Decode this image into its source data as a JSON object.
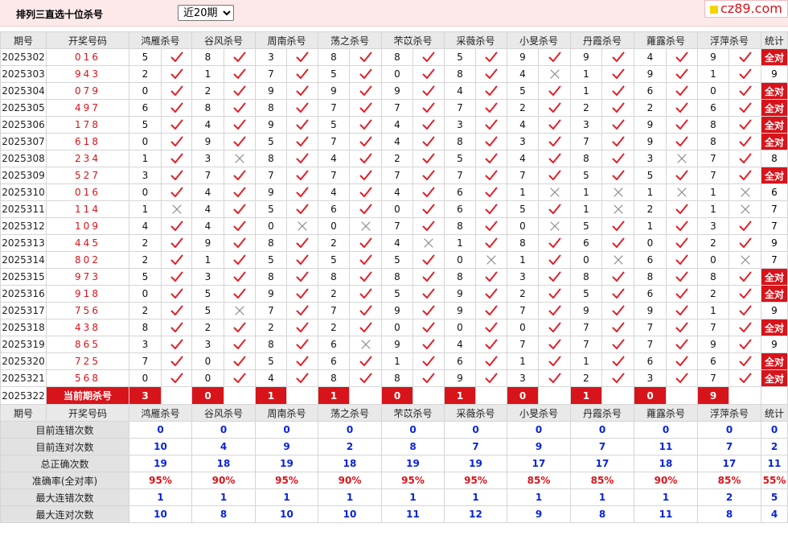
{
  "header": {
    "title": "排列三直选十位杀号",
    "period_selected": "近20期",
    "logo_text": "cz89.com"
  },
  "columns": {
    "period": "期号",
    "draw": "开奖号码",
    "experts": [
      "鸿雁杀号",
      "谷风杀号",
      "周南杀号",
      "荡之杀号",
      "芣苡杀号",
      "采薇杀号",
      "小旻杀号",
      "丹霞杀号",
      "蕹露杀号",
      "浮萍杀号"
    ],
    "stats": "统计"
  },
  "rows": [
    {
      "period": "2025302",
      "draw": "016",
      "kills": [
        [
          5,
          1
        ],
        [
          8,
          1
        ],
        [
          3,
          1
        ],
        [
          8,
          1
        ],
        [
          8,
          1
        ],
        [
          5,
          1
        ],
        [
          9,
          1
        ],
        [
          9,
          1
        ],
        [
          4,
          1
        ],
        [
          9,
          1
        ]
      ],
      "stat": "全对"
    },
    {
      "period": "2025303",
      "draw": "943",
      "kills": [
        [
          2,
          1
        ],
        [
          1,
          1
        ],
        [
          7,
          1
        ],
        [
          5,
          1
        ],
        [
          0,
          1
        ],
        [
          8,
          1
        ],
        [
          4,
          0
        ],
        [
          1,
          1
        ],
        [
          9,
          1
        ],
        [
          1,
          1
        ]
      ],
      "stat": "9"
    },
    {
      "period": "2025304",
      "draw": "079",
      "kills": [
        [
          0,
          1
        ],
        [
          2,
          1
        ],
        [
          9,
          1
        ],
        [
          9,
          1
        ],
        [
          9,
          1
        ],
        [
          4,
          1
        ],
        [
          5,
          1
        ],
        [
          1,
          1
        ],
        [
          6,
          1
        ],
        [
          0,
          1
        ]
      ],
      "stat": "全对"
    },
    {
      "period": "2025305",
      "draw": "497",
      "kills": [
        [
          6,
          1
        ],
        [
          8,
          1
        ],
        [
          8,
          1
        ],
        [
          7,
          1
        ],
        [
          7,
          1
        ],
        [
          7,
          1
        ],
        [
          2,
          1
        ],
        [
          2,
          1
        ],
        [
          2,
          1
        ],
        [
          6,
          1
        ]
      ],
      "stat": "全对"
    },
    {
      "period": "2025306",
      "draw": "178",
      "kills": [
        [
          5,
          1
        ],
        [
          4,
          1
        ],
        [
          9,
          1
        ],
        [
          5,
          1
        ],
        [
          4,
          1
        ],
        [
          3,
          1
        ],
        [
          4,
          1
        ],
        [
          3,
          1
        ],
        [
          9,
          1
        ],
        [
          8,
          1
        ]
      ],
      "stat": "全对"
    },
    {
      "period": "2025307",
      "draw": "618",
      "kills": [
        [
          0,
          1
        ],
        [
          9,
          1
        ],
        [
          5,
          1
        ],
        [
          7,
          1
        ],
        [
          4,
          1
        ],
        [
          8,
          1
        ],
        [
          3,
          1
        ],
        [
          7,
          1
        ],
        [
          9,
          1
        ],
        [
          8,
          1
        ]
      ],
      "stat": "全对"
    },
    {
      "period": "2025308",
      "draw": "234",
      "kills": [
        [
          1,
          1
        ],
        [
          3,
          0
        ],
        [
          8,
          1
        ],
        [
          4,
          1
        ],
        [
          2,
          1
        ],
        [
          5,
          1
        ],
        [
          4,
          1
        ],
        [
          8,
          1
        ],
        [
          3,
          0
        ],
        [
          7,
          1
        ]
      ],
      "stat": "8"
    },
    {
      "period": "2025309",
      "draw": "527",
      "kills": [
        [
          3,
          1
        ],
        [
          7,
          1
        ],
        [
          7,
          1
        ],
        [
          7,
          1
        ],
        [
          7,
          1
        ],
        [
          7,
          1
        ],
        [
          7,
          1
        ],
        [
          5,
          1
        ],
        [
          5,
          1
        ],
        [
          7,
          1
        ]
      ],
      "stat": "全对"
    },
    {
      "period": "2025310",
      "draw": "016",
      "kills": [
        [
          0,
          1
        ],
        [
          4,
          1
        ],
        [
          9,
          1
        ],
        [
          4,
          1
        ],
        [
          4,
          1
        ],
        [
          6,
          1
        ],
        [
          1,
          0
        ],
        [
          1,
          0
        ],
        [
          1,
          0
        ],
        [
          1,
          0
        ]
      ],
      "stat": "6"
    },
    {
      "period": "2025311",
      "draw": "114",
      "kills": [
        [
          1,
          0
        ],
        [
          4,
          1
        ],
        [
          5,
          1
        ],
        [
          6,
          1
        ],
        [
          0,
          1
        ],
        [
          6,
          1
        ],
        [
          5,
          1
        ],
        [
          1,
          0
        ],
        [
          2,
          1
        ],
        [
          1,
          0
        ]
      ],
      "stat": "7"
    },
    {
      "period": "2025312",
      "draw": "109",
      "kills": [
        [
          4,
          1
        ],
        [
          4,
          1
        ],
        [
          0,
          0
        ],
        [
          0,
          0
        ],
        [
          7,
          1
        ],
        [
          8,
          1
        ],
        [
          0,
          0
        ],
        [
          5,
          1
        ],
        [
          1,
          1
        ],
        [
          3,
          1
        ]
      ],
      "stat": "7"
    },
    {
      "period": "2025313",
      "draw": "445",
      "kills": [
        [
          2,
          1
        ],
        [
          9,
          1
        ],
        [
          8,
          1
        ],
        [
          2,
          1
        ],
        [
          4,
          0
        ],
        [
          1,
          1
        ],
        [
          8,
          1
        ],
        [
          6,
          1
        ],
        [
          0,
          1
        ],
        [
          2,
          1
        ]
      ],
      "stat": "9"
    },
    {
      "period": "2025314",
      "draw": "802",
      "kills": [
        [
          2,
          1
        ],
        [
          1,
          1
        ],
        [
          5,
          1
        ],
        [
          5,
          1
        ],
        [
          5,
          1
        ],
        [
          0,
          0
        ],
        [
          1,
          1
        ],
        [
          0,
          0
        ],
        [
          6,
          1
        ],
        [
          0,
          0
        ]
      ],
      "stat": "7"
    },
    {
      "period": "2025315",
      "draw": "973",
      "kills": [
        [
          5,
          1
        ],
        [
          3,
          1
        ],
        [
          8,
          1
        ],
        [
          8,
          1
        ],
        [
          8,
          1
        ],
        [
          8,
          1
        ],
        [
          3,
          1
        ],
        [
          8,
          1
        ],
        [
          8,
          1
        ],
        [
          8,
          1
        ]
      ],
      "stat": "全对"
    },
    {
      "period": "2025316",
      "draw": "918",
      "kills": [
        [
          0,
          1
        ],
        [
          5,
          1
        ],
        [
          9,
          1
        ],
        [
          2,
          1
        ],
        [
          5,
          1
        ],
        [
          9,
          1
        ],
        [
          2,
          1
        ],
        [
          5,
          1
        ],
        [
          6,
          1
        ],
        [
          2,
          1
        ]
      ],
      "stat": "全对"
    },
    {
      "period": "2025317",
      "draw": "756",
      "kills": [
        [
          2,
          1
        ],
        [
          5,
          0
        ],
        [
          7,
          1
        ],
        [
          7,
          1
        ],
        [
          9,
          1
        ],
        [
          9,
          1
        ],
        [
          7,
          1
        ],
        [
          9,
          1
        ],
        [
          9,
          1
        ],
        [
          1,
          1
        ]
      ],
      "stat": "9"
    },
    {
      "period": "2025318",
      "draw": "438",
      "kills": [
        [
          8,
          1
        ],
        [
          2,
          1
        ],
        [
          2,
          1
        ],
        [
          2,
          1
        ],
        [
          0,
          1
        ],
        [
          0,
          1
        ],
        [
          0,
          1
        ],
        [
          7,
          1
        ],
        [
          7,
          1
        ],
        [
          7,
          1
        ]
      ],
      "stat": "全对"
    },
    {
      "period": "2025319",
      "draw": "865",
      "kills": [
        [
          3,
          1
        ],
        [
          3,
          1
        ],
        [
          8,
          1
        ],
        [
          6,
          0
        ],
        [
          9,
          1
        ],
        [
          4,
          1
        ],
        [
          7,
          1
        ],
        [
          7,
          1
        ],
        [
          7,
          1
        ],
        [
          9,
          1
        ]
      ],
      "stat": "9"
    },
    {
      "period": "2025320",
      "draw": "725",
      "kills": [
        [
          7,
          1
        ],
        [
          0,
          1
        ],
        [
          5,
          1
        ],
        [
          6,
          1
        ],
        [
          1,
          1
        ],
        [
          6,
          1
        ],
        [
          1,
          1
        ],
        [
          1,
          1
        ],
        [
          6,
          1
        ],
        [
          6,
          1
        ]
      ],
      "stat": "全对"
    },
    {
      "period": "2025321",
      "draw": "568",
      "kills": [
        [
          0,
          1
        ],
        [
          0,
          1
        ],
        [
          4,
          1
        ],
        [
          8,
          1
        ],
        [
          8,
          1
        ],
        [
          9,
          1
        ],
        [
          3,
          1
        ],
        [
          2,
          1
        ],
        [
          3,
          1
        ],
        [
          7,
          1
        ]
      ],
      "stat": "全对"
    }
  ],
  "current": {
    "period": "2025322",
    "label": "当前期杀号",
    "kills": [
      "3",
      "0",
      "1",
      "1",
      "0",
      "1",
      "0",
      "1",
      "0",
      "9"
    ]
  },
  "stats_rows": [
    {
      "label": "目前连错次数",
      "values": [
        "0",
        "0",
        "0",
        "0",
        "0",
        "0",
        "0",
        "0",
        "0",
        "0",
        "0"
      ],
      "pct": false
    },
    {
      "label": "目前连对次数",
      "values": [
        "10",
        "4",
        "9",
        "2",
        "8",
        "7",
        "9",
        "7",
        "11",
        "7",
        "2"
      ],
      "pct": false
    },
    {
      "label": "总正确次数",
      "values": [
        "19",
        "18",
        "19",
        "18",
        "19",
        "19",
        "17",
        "17",
        "18",
        "17",
        "11"
      ],
      "pct": false
    },
    {
      "label": "准确率(全对率)",
      "values": [
        "95%",
        "90%",
        "95%",
        "90%",
        "95%",
        "95%",
        "85%",
        "85%",
        "90%",
        "85%",
        "55%"
      ],
      "pct": true
    },
    {
      "label": "最大连错次数",
      "values": [
        "1",
        "1",
        "1",
        "1",
        "1",
        "1",
        "1",
        "1",
        "1",
        "2",
        "5"
      ],
      "pct": false
    },
    {
      "label": "最大连对次数",
      "values": [
        "10",
        "8",
        "10",
        "10",
        "11",
        "12",
        "9",
        "8",
        "11",
        "8",
        "4"
      ],
      "pct": false
    }
  ],
  "colors": {
    "accent_red": "#d8141b",
    "stat_blue": "#0b24d8",
    "check_red": "#e0202a",
    "cross_gray": "#8a8a8a"
  }
}
